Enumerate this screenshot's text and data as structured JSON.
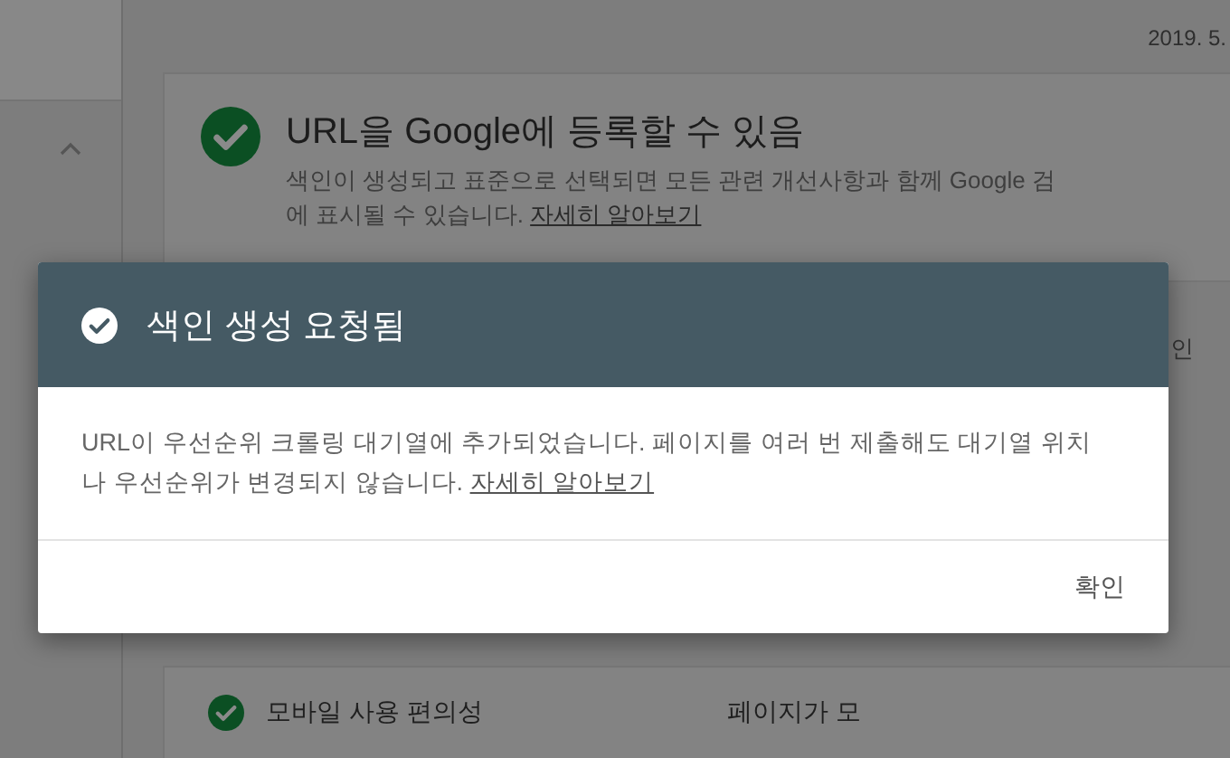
{
  "page": {
    "date": "2019. 5.",
    "status_card": {
      "title": "URL을 Google에 등록할 수 있음",
      "description": "색인이 생성되고 표준으로 선택되면 모든 관련 개선사항과 함께 Google 검",
      "description_2": "에 표시될 수 있습니다.",
      "link": "자세히 알아보기"
    },
    "side_button": "인",
    "enhancement_row": {
      "label": "모바일 사용 편의성",
      "value": "페이지가 모"
    }
  },
  "dialog": {
    "title": "색인 생성 요청됨",
    "message": "URL이 우선순위 크롤링 대기열에 추가되었습니다. 페이지를 여러 번 제출해도 대기열 위치나 우선순위가 변경되지 않습니다.",
    "link": "자세히 알아보기",
    "button": "확인"
  }
}
